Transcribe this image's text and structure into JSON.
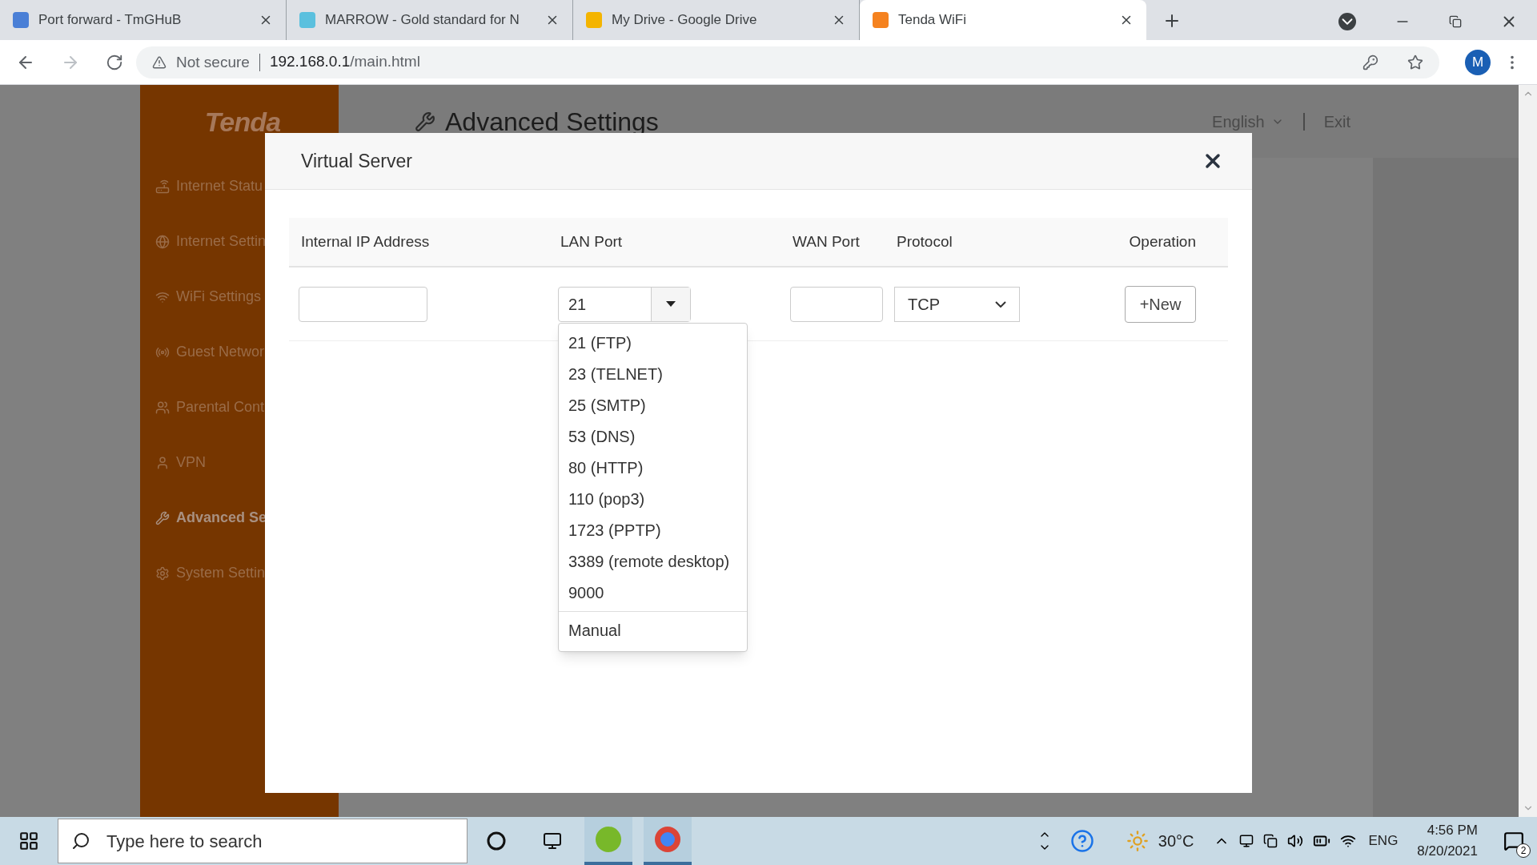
{
  "browser": {
    "tabs": [
      {
        "title": "Port forward - TmGHuB",
        "selected": false
      },
      {
        "title": "MARROW - Gold standard for N",
        "selected": false
      },
      {
        "title": "My Drive - Google Drive",
        "selected": false
      },
      {
        "title": "Tenda WiFi",
        "selected": true
      }
    ],
    "security": "Not secure",
    "url_host": "192.168.0.1",
    "url_path": "/main.html",
    "profile_initial": "M"
  },
  "page": {
    "logo": "Tenda",
    "heading": "Advanced Settings",
    "language": "English",
    "exit": "Exit",
    "sidebar": [
      {
        "label": "Internet Statu",
        "selected": false
      },
      {
        "label": "Internet Settin",
        "selected": false
      },
      {
        "label": "WiFi Settings",
        "selected": false
      },
      {
        "label": "Guest Networ",
        "selected": false
      },
      {
        "label": "Parental Cont",
        "selected": false
      },
      {
        "label": "VPN",
        "selected": false
      },
      {
        "label": "Advanced Se",
        "selected": true
      },
      {
        "label": "System Settin",
        "selected": false
      }
    ]
  },
  "dialog": {
    "title": "Virtual Server",
    "columns": [
      "Internal IP Address",
      "LAN Port",
      "WAN Port",
      "Protocol",
      "Operation"
    ],
    "lan_port": "21",
    "protocol": "TCP",
    "new_button": "+New",
    "lan_options": [
      {
        "label": "21 (FTP)",
        "kind": "preset"
      },
      {
        "label": "23 (TELNET)",
        "kind": "preset"
      },
      {
        "label": "25 (SMTP)",
        "kind": "preset"
      },
      {
        "label": "53 (DNS)",
        "kind": "preset"
      },
      {
        "label": "80 (HTTP)",
        "kind": "preset"
      },
      {
        "label": "110 (pop3)",
        "kind": "preset"
      },
      {
        "label": "1723 (PPTP)",
        "kind": "preset"
      },
      {
        "label": "3389 (remote desktop)",
        "kind": "preset"
      },
      {
        "label": "9000",
        "kind": "preset"
      },
      {
        "label": "Manual",
        "kind": "manual"
      }
    ]
  },
  "taskbar": {
    "search_placeholder": "Type here to search",
    "temperature": "30°C",
    "language": "ENG",
    "time": "4:56 PM",
    "date": "8/20/2021",
    "notifications": "2"
  }
}
